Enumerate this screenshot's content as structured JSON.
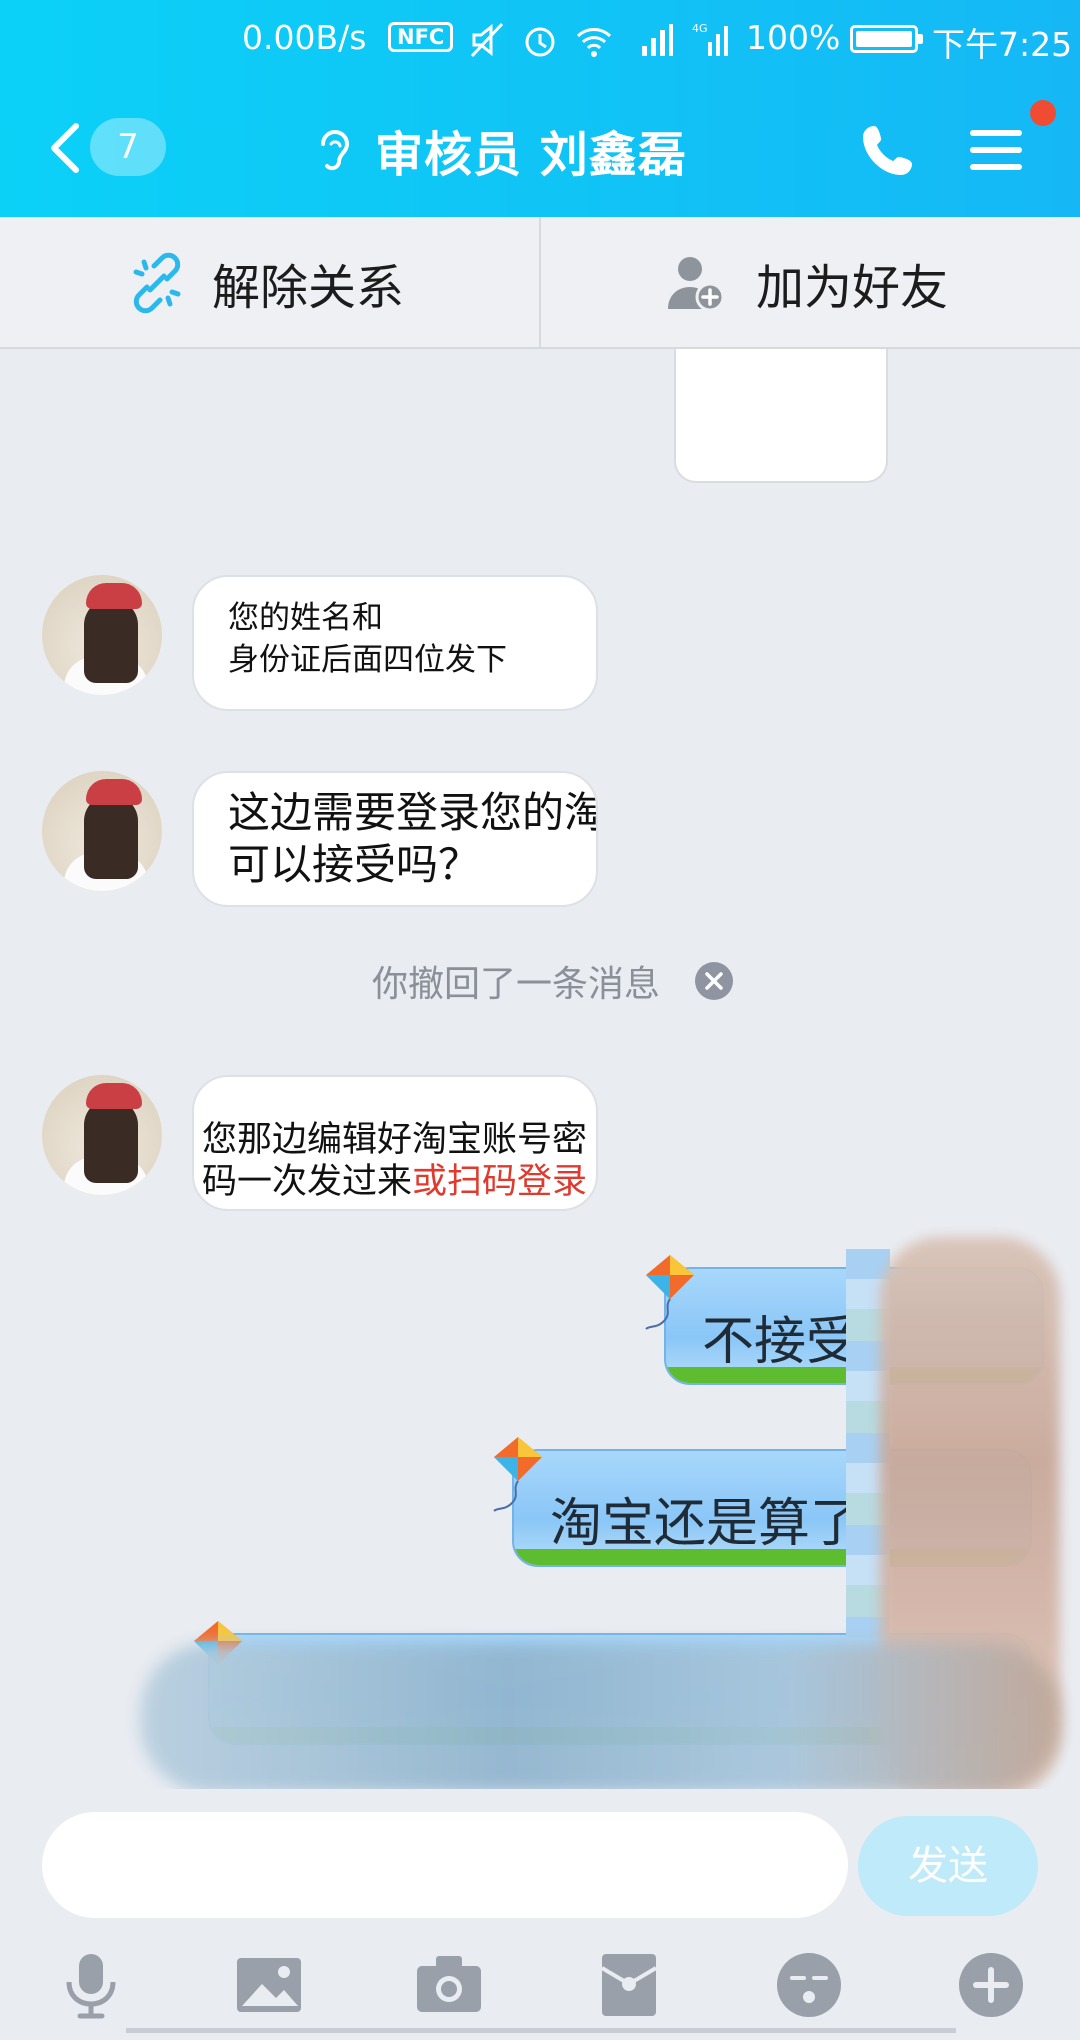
{
  "status_bar": {
    "net_speed": "0.00B/s",
    "nfc": "NFC",
    "network": "4G",
    "battery_pct": "100%",
    "time": "下午7:25"
  },
  "header": {
    "back_badge": "7",
    "title": "审核员 刘鑫磊",
    "accent_color": "#12c6f6",
    "notification_color": "#f04b33"
  },
  "actions": {
    "unlink_label": "解除关系",
    "add_friend_label": "加为好友"
  },
  "messages": {
    "m1": {
      "line1": "您的姓名和",
      "line2": "身份证后面四位发下"
    },
    "m2": {
      "line1": "这边需要登录您的淘",
      "line2": "可以接受吗？"
    },
    "recall_notice": "你撤回了一条消息",
    "m3": {
      "line1": "您那边编辑好淘宝账号密",
      "line2_black": "码一次发过来",
      "line2_red": "或扫码登录"
    },
    "sent1": "不接受",
    "sent2": "淘宝还是算了"
  },
  "composer": {
    "input_value": "",
    "send_label": "发送"
  },
  "toolbar": {
    "icons": [
      "mic-icon",
      "image-icon",
      "camera-icon",
      "red-packet-icon",
      "emoji-icon",
      "plus-icon"
    ]
  }
}
